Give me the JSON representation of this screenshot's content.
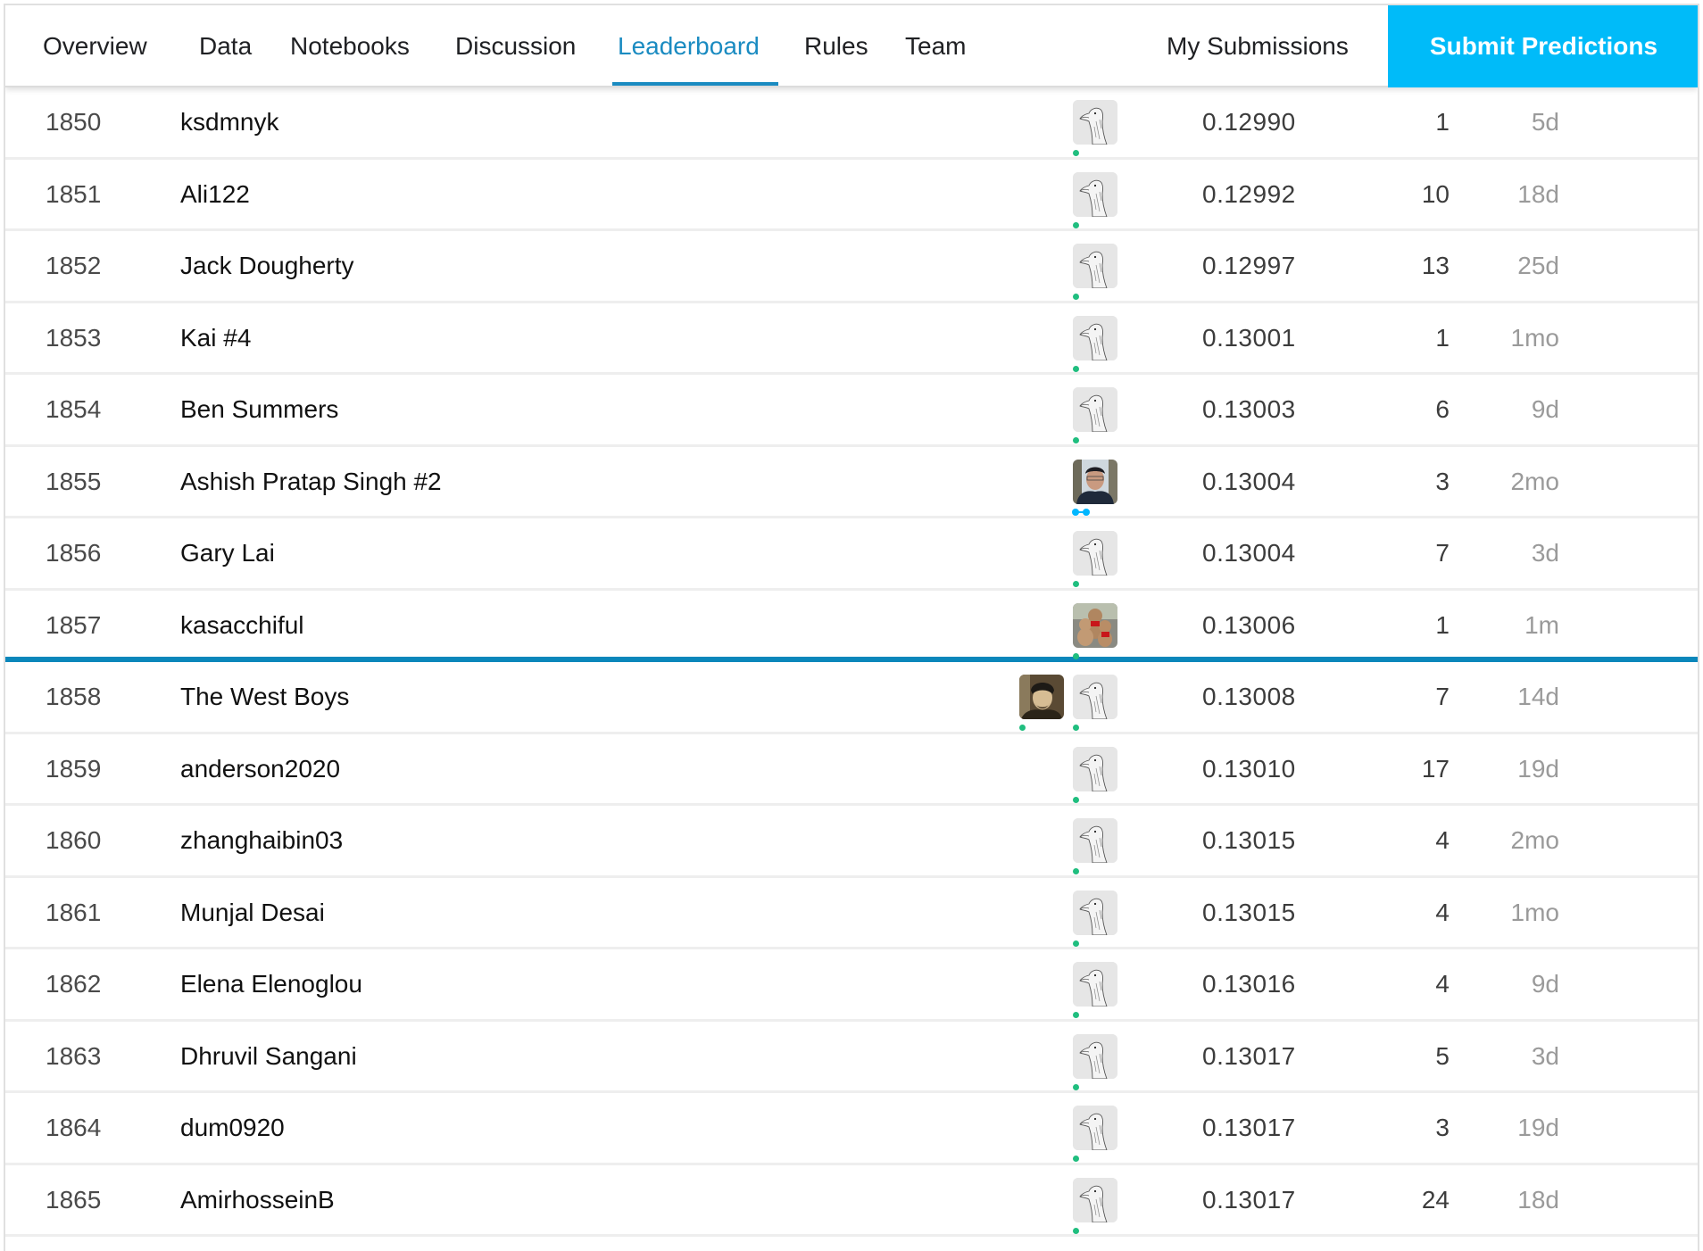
{
  "nav": {
    "tabs": [
      {
        "label": "Overview"
      },
      {
        "label": "Data"
      },
      {
        "label": "Notebooks"
      },
      {
        "label": "Discussion"
      },
      {
        "label": "Leaderboard",
        "active": true
      },
      {
        "label": "Rules"
      },
      {
        "label": "Team"
      }
    ],
    "my_submissions": "My Submissions",
    "submit_predictions": "Submit Predictions"
  },
  "colors": {
    "accent": "#1a8bc1",
    "submit_button": "#00bbf9",
    "cutoff_line": "#0a87bb",
    "tier_contributor": "#20be7f",
    "tier_expert": "#00b7ff"
  },
  "leaderboard": {
    "rows": [
      {
        "rank": "1850",
        "team": "ksdmnyk",
        "avatars": [
          {
            "icon": "default-goose-avatar",
            "tier": "contributor"
          }
        ],
        "score": "0.12990",
        "entries": "1",
        "last": "5d"
      },
      {
        "rank": "1851",
        "team": "Ali122",
        "avatars": [
          {
            "icon": "default-goose-avatar",
            "tier": "contributor"
          }
        ],
        "score": "0.12992",
        "entries": "10",
        "last": "18d"
      },
      {
        "rank": "1852",
        "team": "Jack Dougherty",
        "avatars": [
          {
            "icon": "default-goose-avatar",
            "tier": "contributor"
          }
        ],
        "score": "0.12997",
        "entries": "13",
        "last": "25d"
      },
      {
        "rank": "1853",
        "team": "Kai #4",
        "avatars": [
          {
            "icon": "default-goose-avatar",
            "tier": "contributor"
          }
        ],
        "score": "0.13001",
        "entries": "1",
        "last": "1mo"
      },
      {
        "rank": "1854",
        "team": "Ben Summers",
        "avatars": [
          {
            "icon": "default-goose-avatar",
            "tier": "contributor"
          }
        ],
        "score": "0.13003",
        "entries": "6",
        "last": "9d"
      },
      {
        "rank": "1855",
        "team": "Ashish Pratap Singh #2",
        "avatars": [
          {
            "icon": "user-photo-avatar",
            "tier": "expert"
          }
        ],
        "score": "0.13004",
        "entries": "3",
        "last": "2mo"
      },
      {
        "rank": "1856",
        "team": "Gary Lai",
        "avatars": [
          {
            "icon": "default-goose-avatar",
            "tier": "contributor"
          }
        ],
        "score": "0.13004",
        "entries": "7",
        "last": "3d"
      },
      {
        "rank": "1857",
        "team": "kasacchiful",
        "avatars": [
          {
            "icon": "teddy-bears-photo-avatar",
            "tier": "contributor"
          }
        ],
        "score": "0.13006",
        "entries": "1",
        "last": "1m",
        "cutoff_below": true
      },
      {
        "rank": "1858",
        "team": "The West Boys",
        "avatars": [
          {
            "icon": "user-photo-avatar",
            "tier": "contributor"
          },
          {
            "icon": "default-goose-avatar",
            "tier": "contributor"
          }
        ],
        "score": "0.13008",
        "entries": "7",
        "last": "14d"
      },
      {
        "rank": "1859",
        "team": "anderson2020",
        "avatars": [
          {
            "icon": "default-goose-avatar",
            "tier": "contributor"
          }
        ],
        "score": "0.13010",
        "entries": "17",
        "last": "19d"
      },
      {
        "rank": "1860",
        "team": "zhanghaibin03",
        "avatars": [
          {
            "icon": "default-goose-avatar",
            "tier": "contributor"
          }
        ],
        "score": "0.13015",
        "entries": "4",
        "last": "2mo"
      },
      {
        "rank": "1861",
        "team": "Munjal Desai",
        "avatars": [
          {
            "icon": "default-goose-avatar",
            "tier": "contributor"
          }
        ],
        "score": "0.13015",
        "entries": "4",
        "last": "1mo"
      },
      {
        "rank": "1862",
        "team": "Elena Elenoglou",
        "avatars": [
          {
            "icon": "default-goose-avatar",
            "tier": "contributor"
          }
        ],
        "score": "0.13016",
        "entries": "4",
        "last": "9d"
      },
      {
        "rank": "1863",
        "team": "Dhruvil Sangani",
        "avatars": [
          {
            "icon": "default-goose-avatar",
            "tier": "contributor"
          }
        ],
        "score": "0.13017",
        "entries": "5",
        "last": "3d"
      },
      {
        "rank": "1864",
        "team": "dum0920",
        "avatars": [
          {
            "icon": "default-goose-avatar",
            "tier": "contributor"
          }
        ],
        "score": "0.13017",
        "entries": "3",
        "last": "19d"
      },
      {
        "rank": "1865",
        "team": "AmirhosseinB",
        "avatars": [
          {
            "icon": "default-goose-avatar",
            "tier": "contributor"
          }
        ],
        "score": "0.13017",
        "entries": "24",
        "last": "18d"
      }
    ]
  }
}
